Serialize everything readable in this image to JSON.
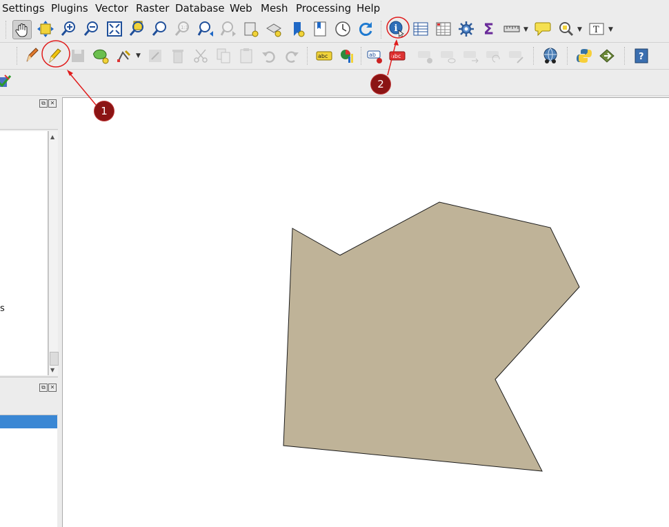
{
  "menus": [
    "Settings",
    "Plugins",
    "Vector",
    "Raster",
    "Database",
    "Web",
    "Mesh",
    "Processing",
    "Help"
  ],
  "layers_panel": {
    "partial_text": "s"
  },
  "callouts": [
    "1",
    "2"
  ],
  "map": {
    "polygon_fill": "#bfb398",
    "polygon_stroke": "#1a1a1a",
    "canvas_bg": "#ffffff"
  },
  "annotation_color": "#e01c1c"
}
